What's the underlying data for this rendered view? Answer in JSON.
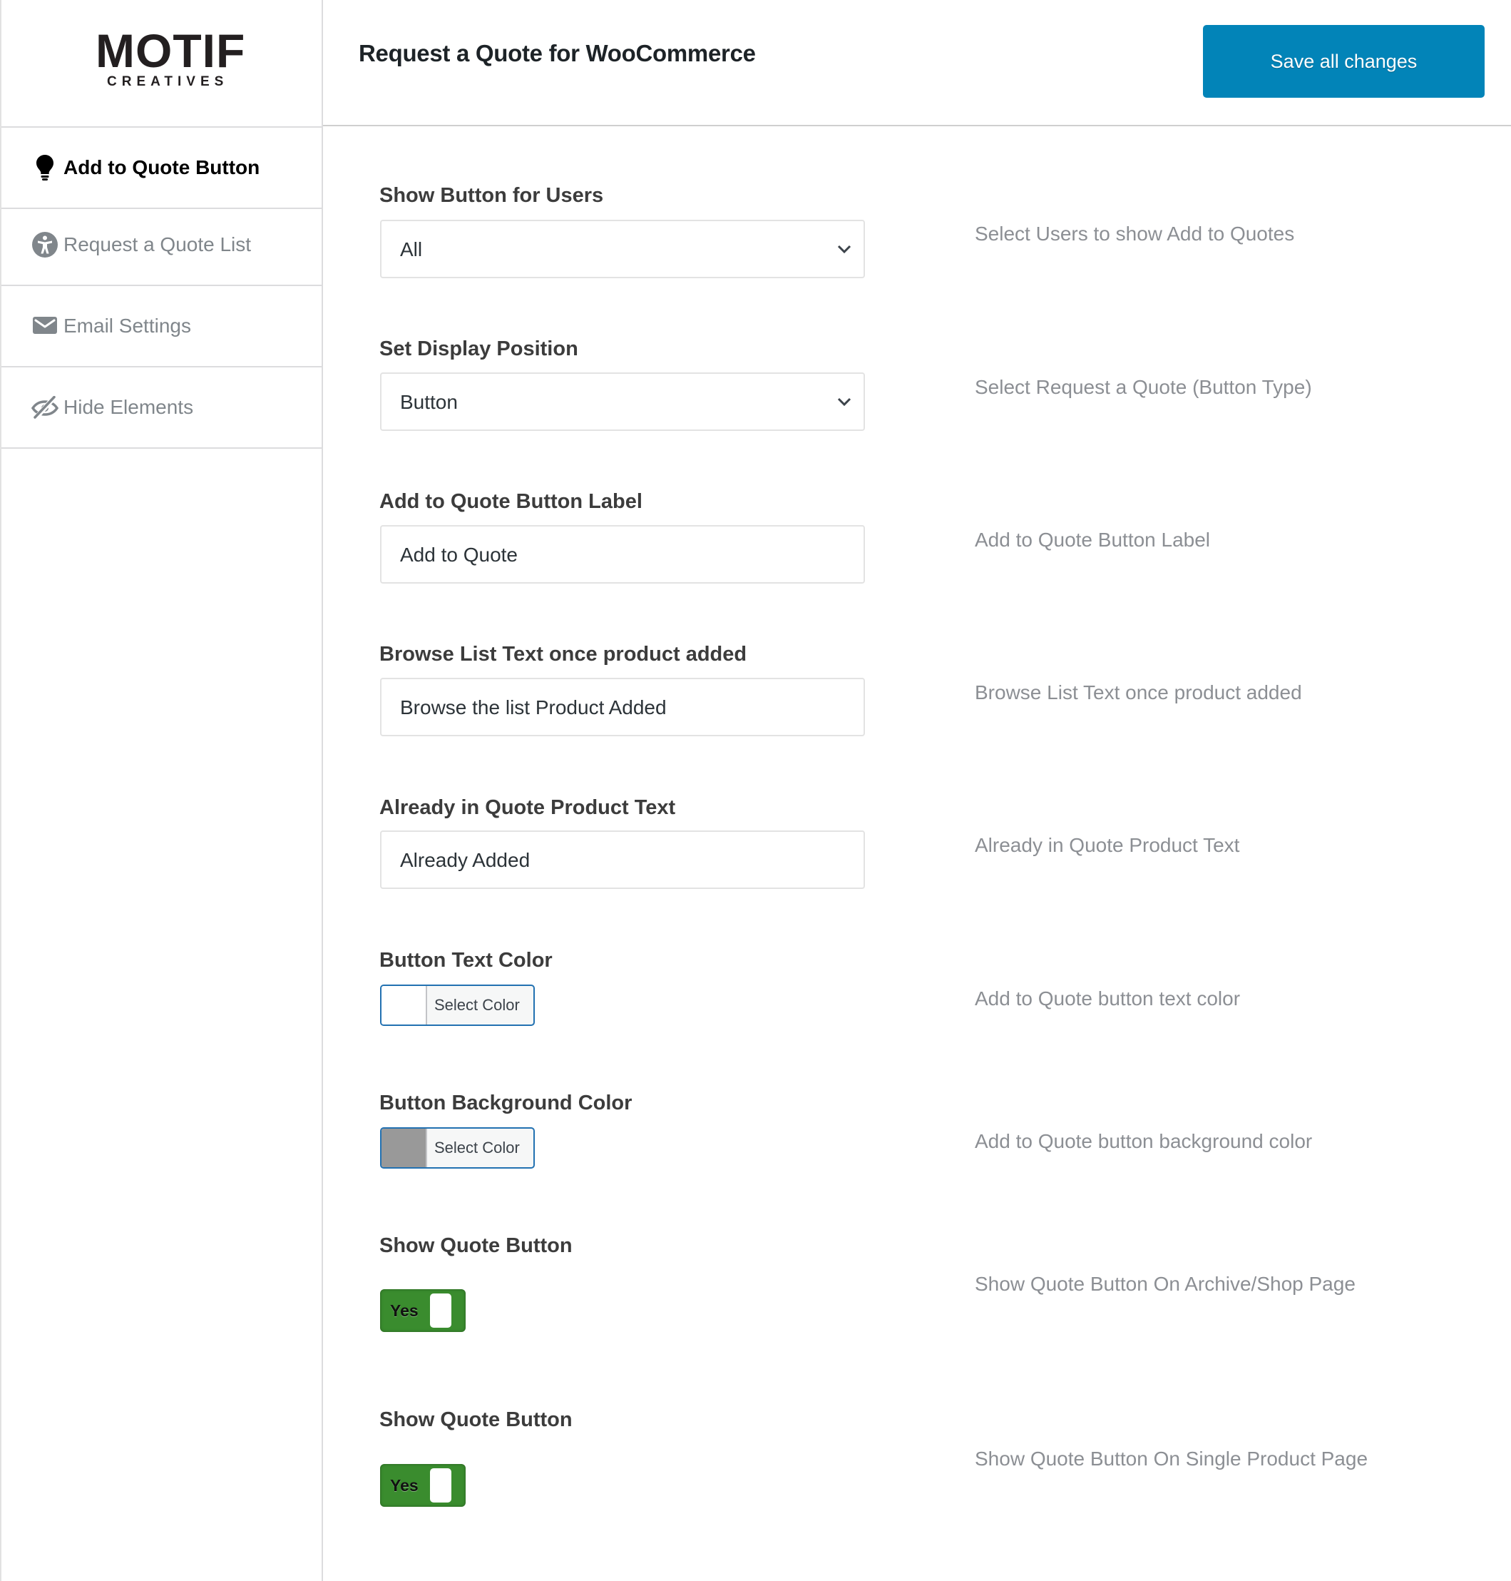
{
  "brand": {
    "logo_main": "MOTIF",
    "logo_sub": "CREATIVES"
  },
  "sidebar": {
    "items": [
      {
        "label": "Add to Quote Button",
        "icon": "lightbulb-icon",
        "active": true
      },
      {
        "label": "Request a Quote List",
        "icon": "accessibility-icon",
        "active": false
      },
      {
        "label": "Email Settings",
        "icon": "envelope-icon",
        "active": false
      },
      {
        "label": "Hide Elements",
        "icon": "eye-slash-icon",
        "active": false
      }
    ]
  },
  "header": {
    "title": "Request a Quote for WooCommerce",
    "save_label": "Save all changes"
  },
  "colors": {
    "accent": "#0284b8",
    "toggle_on": "#3a8c2e",
    "color_border": "#2271b1",
    "bg_color_value": "#999999",
    "text_color_value": "#ffffff"
  },
  "fields": [
    {
      "label": "Show Button for Users",
      "type": "select",
      "value": "All",
      "description": "Select Users to show Add to Quotes"
    },
    {
      "label": "Set Display Position",
      "type": "select",
      "value": "Button",
      "description": "Select Request a Quote (Button Type)"
    },
    {
      "label": "Add to Quote Button Label",
      "type": "text",
      "value": "Add to Quote",
      "description": "Add to Quote Button Label"
    },
    {
      "label": "Browse List Text once product added",
      "type": "text",
      "value": "Browse the list Product Added",
      "description": "Browse List Text once product added"
    },
    {
      "label": "Already in Quote Product Text",
      "type": "text",
      "value": "Already Added",
      "description": "Already in Quote Product Text"
    },
    {
      "label": "Button Text Color",
      "type": "color",
      "button_label": "Select Color",
      "description": "Add to Quote button text color"
    },
    {
      "label": "Button Background Color",
      "type": "color",
      "button_label": "Select Color",
      "description": "Add to Quote button background color"
    },
    {
      "label": "Show Quote Button",
      "type": "toggle",
      "state_label": "Yes",
      "checked": true,
      "description": "Show Quote Button On Archive/Shop Page"
    },
    {
      "label": "Show Quote Button",
      "type": "toggle",
      "state_label": "Yes",
      "checked": true,
      "description": "Show Quote Button On Single Product Page"
    }
  ]
}
